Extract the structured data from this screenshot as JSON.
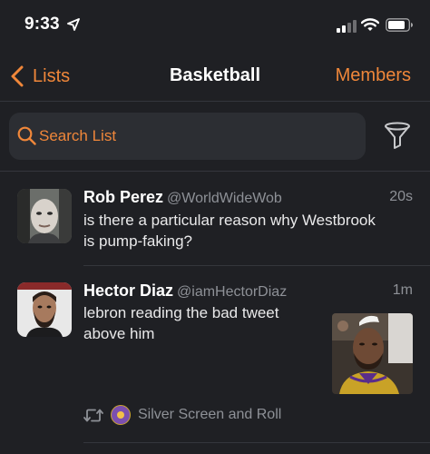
{
  "status_bar": {
    "time": "9:33"
  },
  "nav": {
    "back_label": "Lists",
    "title": "Basketball",
    "members_label": "Members"
  },
  "search": {
    "placeholder": "Search List"
  },
  "tweets": [
    {
      "name": "Rob Perez",
      "handle": "@WorldWideWob",
      "time": "20s",
      "text_lines": [
        "is there a particular reason why Westbrook",
        "is pump-faking?"
      ]
    },
    {
      "name": "Hector Diaz",
      "handle": "@iamHectorDiaz",
      "time": "1m",
      "text_lines": [
        "lebron reading the bad tweet",
        "above him"
      ],
      "retweeted_by": "Silver Screen and Roll"
    }
  ],
  "colors": {
    "accent": "#f0873a",
    "background": "#1f2024",
    "muted": "#8e9197"
  }
}
